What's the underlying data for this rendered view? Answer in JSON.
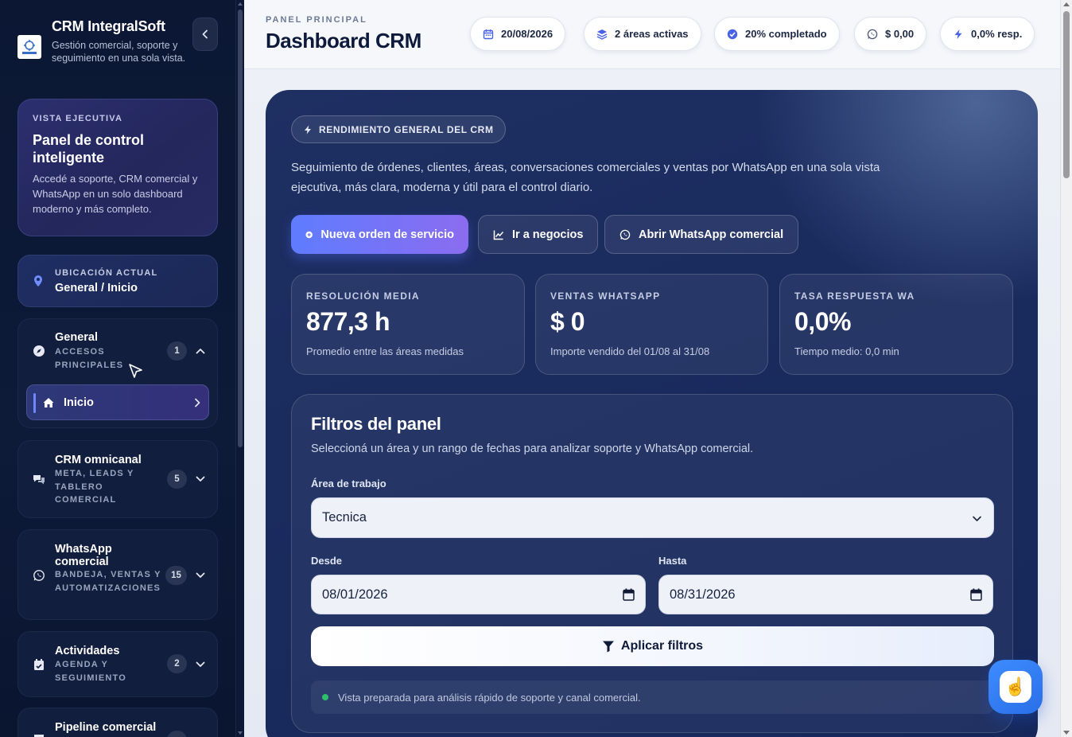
{
  "sidebar": {
    "brand": {
      "title": "CRM IntegralSoft",
      "subtitle": "Gestión comercial, soporte y seguimiento en una sola vista."
    },
    "exec_card": {
      "eyebrow": "VISTA EJECUTIVA",
      "title": "Panel de control inteligente",
      "text": "Accedé a soporte, CRM comercial y WhatsApp en un solo dashboard moderno y más completo."
    },
    "location": {
      "eyebrow": "UBICACIÓN ACTUAL",
      "value": "General / Inicio"
    },
    "groups": [
      {
        "title": "General",
        "subtitle": "ACCESOS PRINCIPALES",
        "count": "1",
        "icon": "compass-icon",
        "expanded": true,
        "items": [
          {
            "label": "Inicio",
            "icon": "home-icon",
            "active": true
          }
        ]
      },
      {
        "title": "CRM omnicanal",
        "subtitle": "META, LEADS Y TABLERO COMERCIAL",
        "count": "5",
        "icon": "chat-bubbles-icon",
        "expanded": false
      },
      {
        "title": "WhatsApp comercial",
        "subtitle": "BANDEJA, VENTAS Y AUTOMATIZACIONES",
        "count": "15",
        "icon": "whatsapp-icon",
        "expanded": false
      },
      {
        "title": "Actividades",
        "subtitle": "AGENDA Y SEGUIMIENTO",
        "count": "2",
        "icon": "calendar-check-icon",
        "expanded": false
      },
      {
        "title": "Pipeline comercial",
        "subtitle": "",
        "count": "",
        "icon": "pipeline-icon",
        "expanded": false
      }
    ]
  },
  "header": {
    "eyebrow": "PANEL PRINCIPAL",
    "title": "Dashboard CRM",
    "chips": [
      {
        "label": "20/08/2026",
        "icon": "calendar-icon"
      },
      {
        "label": "2 áreas activas",
        "icon": "layers-icon"
      },
      {
        "label": "20% completado",
        "icon": "check-circle-icon"
      },
      {
        "label": "$ 0,00",
        "icon": "whatsapp-icon"
      },
      {
        "label": "0,0% resp.",
        "icon": "bolt-icon"
      }
    ]
  },
  "hero": {
    "pill": "RENDIMIENTO GENERAL DEL CRM",
    "description": "Seguimiento de órdenes, clientes, áreas, conversaciones comerciales y ventas por WhatsApp en una sola vista ejecutiva, más clara, moderna y útil para el control diario.",
    "buttons": {
      "new_order": "Nueva orden de servicio",
      "deals": "Ir a negocios",
      "whatsapp": "Abrir WhatsApp comercial"
    },
    "kpis": [
      {
        "label": "RESOLUCIÓN MEDIA",
        "value": "877,3 h",
        "foot": "Promedio entre las áreas medidas"
      },
      {
        "label": "VENTAS WHATSAPP",
        "value": "$ 0",
        "foot": "Importe vendido del 01/08 al 31/08"
      },
      {
        "label": "TASA RESPUESTA WA",
        "value": "0,0%",
        "foot": "Tiempo medio: 0,0 min"
      }
    ]
  },
  "filters": {
    "title": "Filtros del panel",
    "description": "Seleccioná un área y un rango de fechas para analizar soporte y WhatsApp comercial.",
    "area_label": "Área de trabajo",
    "area_value": "Tecnica",
    "from_label": "Desde",
    "from_value": "08/01/2026",
    "to_label": "Hasta",
    "to_value": "08/31/2026",
    "apply_label": "Aplicar filtros",
    "note": "Vista preparada para análisis rápido de soporte y canal comercial."
  },
  "fab": {
    "icon": "pointing-hand-icon",
    "glyph": "☝️"
  },
  "colors": {
    "accent": "#5f7cff",
    "accent_2": "#8b6cf0",
    "sidebar_bg": "#0b1733",
    "hero_bg": "#1a2b5e",
    "status_ok": "#2ec06b"
  }
}
